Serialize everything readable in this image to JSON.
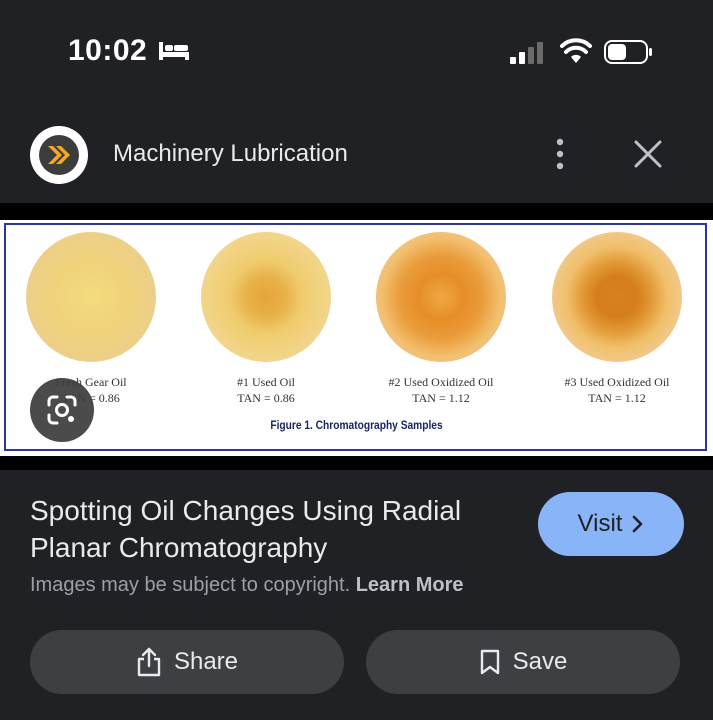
{
  "status_bar": {
    "time": "10:02",
    "icons": [
      "bed-icon",
      "cellular-signal-icon",
      "wifi-icon",
      "battery-icon"
    ]
  },
  "source": {
    "name": "Machinery Lubrication",
    "logo_icon": "double-chevron-logo",
    "more_icon": "more-vertical-icon",
    "close_icon": "close-icon"
  },
  "figure": {
    "samples": [
      {
        "label": "Fresh Gear Oil",
        "tan": "TAN = 0.86"
      },
      {
        "label": "#1 Used Oil",
        "tan": "TAN = 0.86"
      },
      {
        "label": "#2 Used Oxidized Oil",
        "tan": "TAN = 1.12"
      },
      {
        "label": "#3 Used Oxidized Oil",
        "tan": "TAN = 1.12"
      }
    ],
    "caption": "Figure 1. Chromatography Samples",
    "lens_icon": "google-lens-icon"
  },
  "result": {
    "title": "Spotting Oil Changes Using Radial Planar Chromatography",
    "visit_label": "Visit",
    "visit_icon": "chevron-right-icon",
    "copyright_text": "Images may be subject to copyright.",
    "learn_more": "Learn More"
  },
  "actions": {
    "share_label": "Share",
    "share_icon": "share-icon",
    "save_label": "Save",
    "save_icon": "bookmark-icon"
  },
  "colors": {
    "background": "#202124",
    "accent": "#8ab4f8",
    "button": "#3c4043",
    "logo_orange": "#f5a623"
  }
}
